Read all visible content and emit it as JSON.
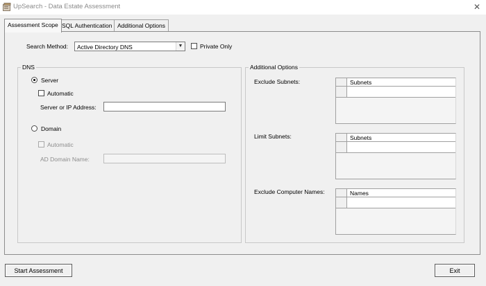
{
  "window": {
    "title": "UpSearch - Data Estate Assessment",
    "close_icon": "close-icon"
  },
  "tabs": [
    {
      "label": "Assessment Scope",
      "active": true
    },
    {
      "label": "SQL Authentication",
      "active": false
    },
    {
      "label": "Additional Options",
      "active": false
    }
  ],
  "scope": {
    "search_method_label": "Search Method:",
    "search_method_value": "Active Directory DNS",
    "private_only_label": "Private Only",
    "private_only_checked": false
  },
  "dns": {
    "group_title": "DNS",
    "server_label": "Server",
    "server_selected": true,
    "server_automatic_label": "Automatic",
    "server_address_label": "Server or IP Address:",
    "server_address_value": "",
    "domain_label": "Domain",
    "domain_selected": false,
    "domain_automatic_label": "Automatic",
    "ad_domain_label": "AD Domain Name:",
    "ad_domain_value": ""
  },
  "additional": {
    "group_title": "Additional Options",
    "exclude_subnets_label": "Exclude Subnets:",
    "exclude_subnets_header": "Subnets",
    "limit_subnets_label": "Limit Subnets:",
    "limit_subnets_header": "Subnets",
    "exclude_names_label": "Exclude Computer Names:",
    "exclude_names_header": "Names"
  },
  "buttons": {
    "start": "Start Assessment",
    "exit": "Exit"
  }
}
